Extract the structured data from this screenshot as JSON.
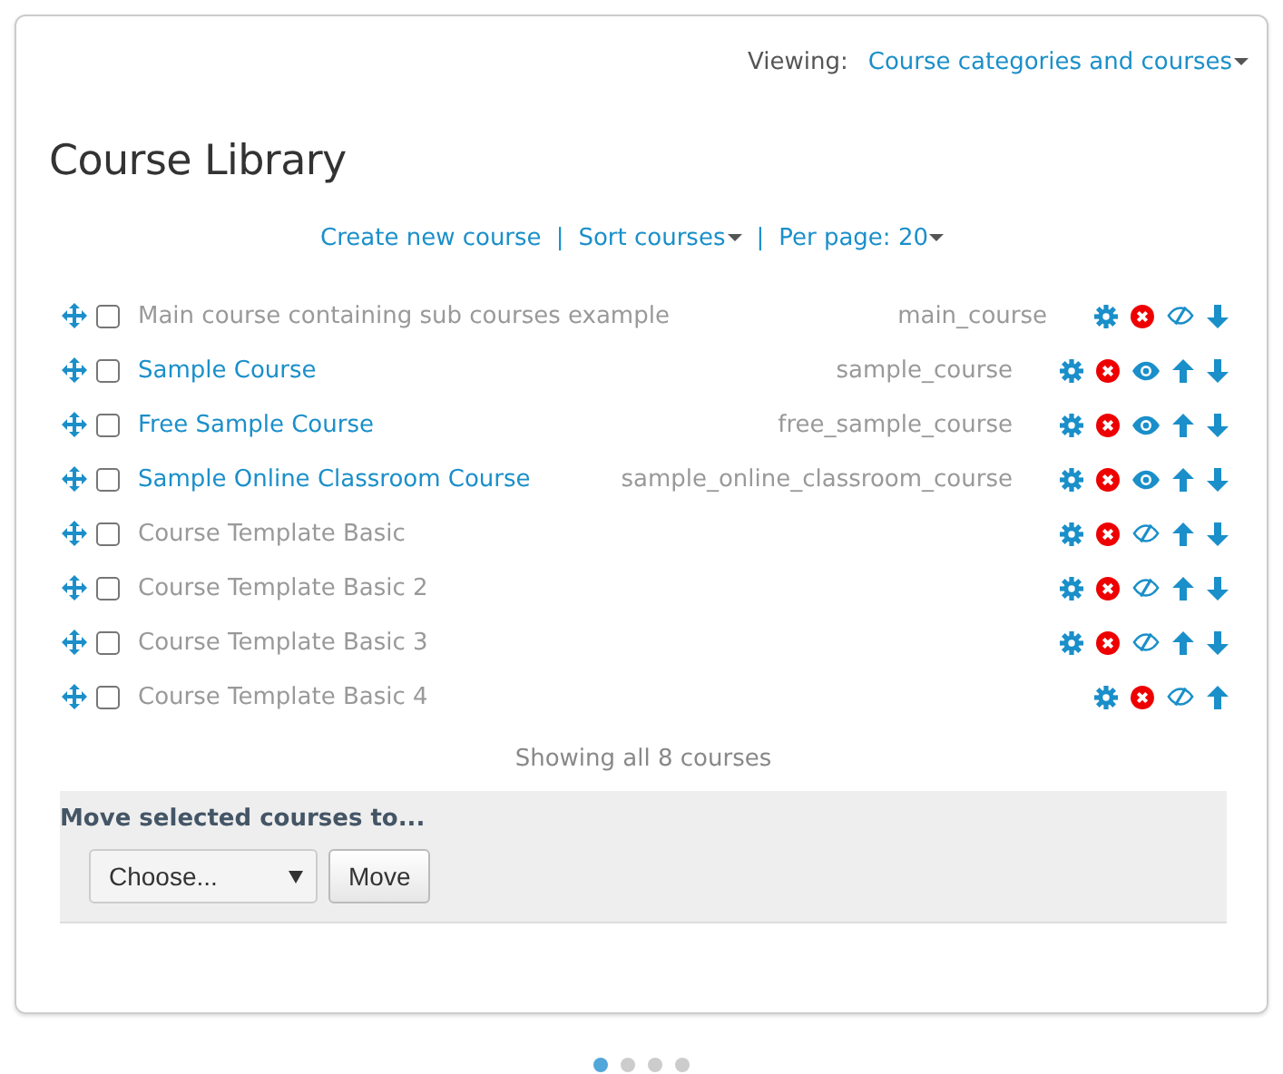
{
  "viewing": {
    "label": "Viewing:",
    "value": "Course categories and courses"
  },
  "title": "Course Library",
  "actions": [
    {
      "label": "Create new course",
      "dropdown": false,
      "separator": "|"
    },
    {
      "label": "Sort courses",
      "dropdown": true,
      "separator": "|"
    },
    {
      "label": "Per page: 20",
      "dropdown": true
    }
  ],
  "courses": [
    {
      "name": "Main course containing sub courses example",
      "shortname": "main_course",
      "visible": false,
      "checked": false,
      "can_move_up": false,
      "can_move_down": true
    },
    {
      "name": "Sample Course",
      "shortname": "sample_course",
      "visible": true,
      "checked": false,
      "can_move_up": true,
      "can_move_down": true
    },
    {
      "name": "Free Sample Course",
      "shortname": "free_sample_course",
      "visible": true,
      "checked": false,
      "can_move_up": true,
      "can_move_down": true
    },
    {
      "name": "Sample Online Classroom Course",
      "shortname": "sample_online_classroom_course",
      "visible": true,
      "checked": false,
      "can_move_up": true,
      "can_move_down": true
    },
    {
      "name": "Course Template Basic",
      "visible": false,
      "checked": false,
      "can_move_up": true,
      "can_move_down": true
    },
    {
      "name": "Course Template Basic 2",
      "visible": false,
      "checked": false,
      "can_move_up": true,
      "can_move_down": true
    },
    {
      "name": "Course Template Basic 3",
      "visible": false,
      "checked": false,
      "can_move_up": true,
      "can_move_down": true
    },
    {
      "name": "Course Template Basic 4",
      "visible": false,
      "checked": false,
      "can_move_up": true,
      "can_move_down": false
    }
  ],
  "summary": "Showing all 8 courses",
  "move_panel": {
    "heading": "Move selected courses to...",
    "select": "Choose...",
    "button": "Move"
  },
  "pager": [
    {
      "selected": true
    },
    {
      "selected": false
    },
    {
      "selected": false
    },
    {
      "selected": false
    }
  ]
}
